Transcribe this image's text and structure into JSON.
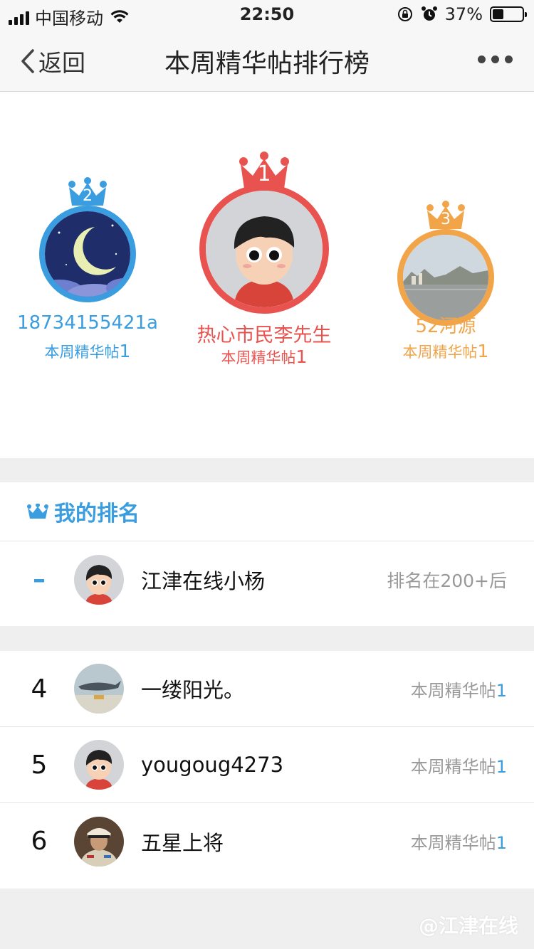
{
  "status_bar": {
    "carrier": "中国移动",
    "time": "22:50",
    "battery_percent": "37%",
    "battery_level": 0.37
  },
  "nav": {
    "back_label": "返回",
    "title": "本周精华帖排行榜",
    "more_icon": "more-dots-icon"
  },
  "podium": {
    "first": {
      "rank": "1",
      "name": "热心市民李先生",
      "posts_label": "本周精华帖",
      "posts_count": "1",
      "color": "#e8534f"
    },
    "second": {
      "rank": "2",
      "name": "18734155421a",
      "posts_label": "本周精华帖",
      "posts_count": "1",
      "color": "#3a9de0"
    },
    "third": {
      "rank": "3",
      "name": "52河源",
      "posts_label": "本周精华帖",
      "posts_count": "1",
      "color": "#f2a449"
    }
  },
  "my_rank": {
    "header": "我的排名",
    "rank": "–",
    "name": "江津在线小杨",
    "info": "排名在200+后"
  },
  "ranking_list": [
    {
      "rank": "4",
      "name": "一缕阳光。",
      "posts_label": "本周精华帖",
      "posts_count": "1"
    },
    {
      "rank": "5",
      "name": "yougoug4273",
      "posts_label": "本周精华帖",
      "posts_count": "1"
    },
    {
      "rank": "6",
      "name": "五星上将",
      "posts_label": "本周精华帖",
      "posts_count": "1"
    }
  ],
  "watermark": "@江津在线",
  "colors": {
    "accent_blue": "#3a9de0",
    "accent_red": "#e8534f",
    "accent_orange": "#f2a449"
  }
}
